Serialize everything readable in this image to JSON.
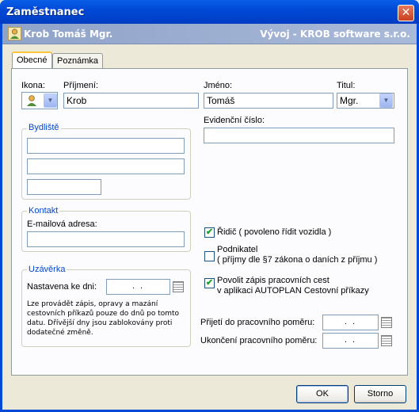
{
  "window": {
    "title": "Zaměstnanec",
    "close_glyph": "✕"
  },
  "header": {
    "employee_name": "Krob Tomáš Mgr.",
    "company": "Vývoj - KROB software s.r.o."
  },
  "tabs": [
    {
      "label": "Obecné",
      "active": true
    },
    {
      "label": "Poznámka",
      "active": false
    }
  ],
  "form": {
    "icon_label": "Ikona:",
    "surname_label": "Příjmení:",
    "surname_value": "Krob",
    "firstname_label": "Jméno:",
    "firstname_value": "Tomáš",
    "title_label": "Titul:",
    "title_value": "Mgr.",
    "evidence_label": "Evidenční číslo:",
    "evidence_value": "",
    "residence_legend": "Bydliště",
    "contact_legend": "Kontakt",
    "email_label": "E-mailová adresa:",
    "email_value": "",
    "closing_legend": "Uzávěrka",
    "closing_set_label": "Nastavena ke dni:",
    "closing_date": ". .",
    "closing_note": "Lze provádět zápis, opravy a mazání cestovních příkazů pouze do dnů po tomto datu. Dřívější dny jsou zablokovány proti dodatečné změně.",
    "driver": {
      "label": "Řidič ( povoleno řídit vozidla )",
      "checked": true
    },
    "entrepreneur": {
      "label_line1": "Podnikatel",
      "label_line2": "( příjmy dle §7 zákona o daních z příjmu )",
      "checked": false
    },
    "autoplan": {
      "label_line1": "Povolit zápis pracovních cest",
      "label_line2": "v aplikaci AUTOPLAN Cestovní příkazy",
      "checked": true
    },
    "hire_label": "Přijetí do pracovního poměru:",
    "hire_date": ". .",
    "termination_label": "Ukončení pracovního poměru:",
    "termination_date": ". ."
  },
  "buttons": {
    "ok": "OK",
    "cancel": "Storno"
  },
  "check_glyph": "✔",
  "dropdown_glyph": "▼",
  "colors": {
    "titlebar": "#0049D6",
    "legend": "#0046D5",
    "header": "#8FA3C9"
  }
}
